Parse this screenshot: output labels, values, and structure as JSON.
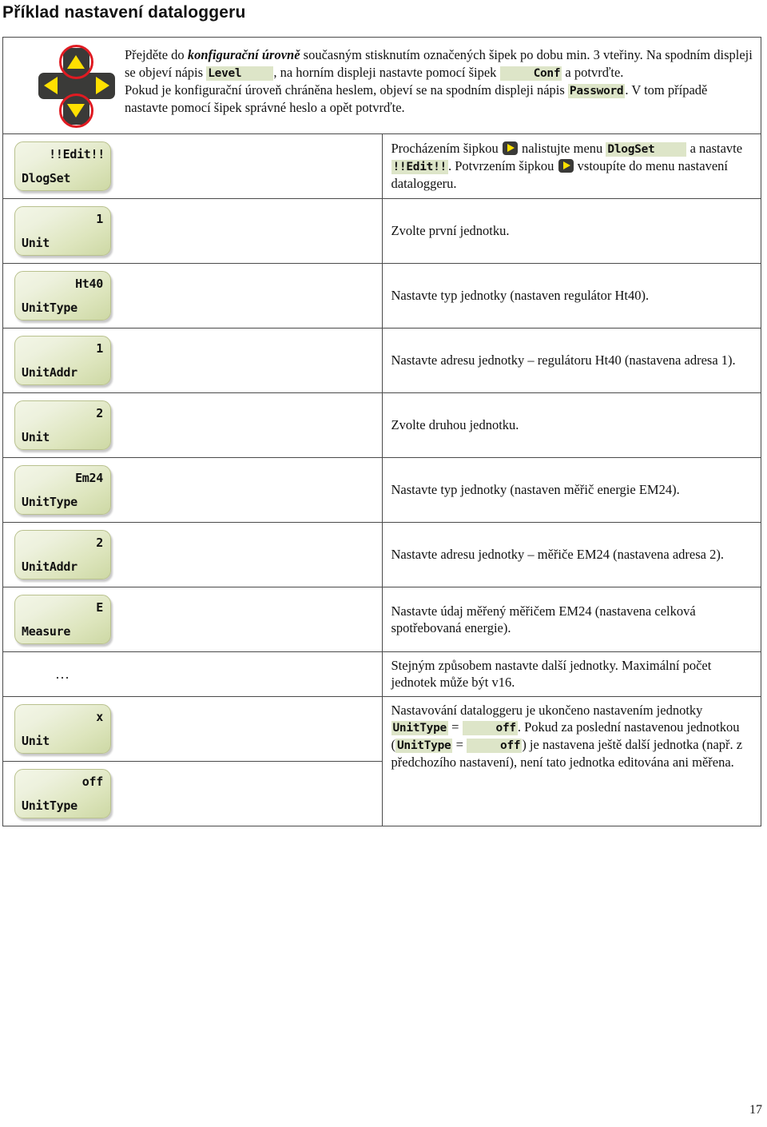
{
  "page": {
    "title": "Příklad nastavení dataloggeru",
    "number": "17"
  },
  "intro": {
    "keypad": {
      "up_icon": "arrow-up-icon",
      "down_icon": "arrow-down-icon",
      "left_icon": "arrow-left-icon",
      "right_icon": "arrow-right-icon"
    },
    "t1": "Přejděte do ",
    "t1_em": "konfigurační úrovně",
    "t2": " současným stisknutím označených šipek po dobu min. 3 vteřiny. Na spodním displeji se objeví nápis ",
    "chip_level": "Level",
    "t3": ", na horním displeji nastavte pomocí šipek ",
    "chip_conf": "Conf",
    "t4": " a potvrďte.",
    "t5": "Pokud je konfigurační úroveň chráněna heslem, objeví se na spodním displeji nápis ",
    "chip_password": "Password",
    "t6": ". V tom případě nastavte pomocí šipek správné heslo a opět potvrďte."
  },
  "rows": [
    {
      "display": {
        "value": "!!Edit!!",
        "label": "DlogSet",
        "wide": true
      },
      "text_parts": {
        "a": "Procházením šipkou ",
        "icon1": "arrow-right-key-icon",
        "b": " nalistujte menu ",
        "chip1": "DlogSet",
        "c": " a nastavte ",
        "chip2": "!!Edit!!",
        "d": ". Potvrzením šipkou ",
        "icon2": "arrow-right-key-icon",
        "e": " vstoupíte do menu nastavení dataloggeru."
      }
    },
    {
      "display": {
        "value": "1",
        "label": "Unit"
      },
      "text": "Zvolte první jednotku."
    },
    {
      "display": {
        "value": "Ht40",
        "label": "UnitType"
      },
      "text": "Nastavte typ jednotky (nastaven regulátor Ht40)."
    },
    {
      "display": {
        "value": "1",
        "label": "UnitAddr"
      },
      "text": "Nastavte adresu jednotky – regulátoru Ht40 (nastavena adresa 1)."
    },
    {
      "display": {
        "value": "2",
        "label": "Unit"
      },
      "text": "Zvolte druhou jednotku."
    },
    {
      "display": {
        "value": "Em24",
        "label": "UnitType"
      },
      "text": "Nastavte typ jednotky (nastaven měřič energie EM24)."
    },
    {
      "display": {
        "value": "2",
        "label": "UnitAddr"
      },
      "text": "Nastavte adresu jednotky – měřiče EM24 (nastavena adresa 2)."
    },
    {
      "display": {
        "value": "E",
        "label": "Measure"
      },
      "text": "Nastavte údaj měřený měřičem EM24 (nastavena celková spotřebovaná energie)."
    },
    {
      "display": {
        "ellipsis": "…"
      },
      "text": "Stejným způsobem nastavte další jednotky. Maximální počet jednotek může být v16."
    },
    {
      "display": {
        "value": "x",
        "label": "Unit"
      },
      "final_text": {
        "a": "Nastavování dataloggeru je ukončeno nastavením jednotky ",
        "chip1": "UnitType",
        "b": " = ",
        "chip2": "off",
        "c": ". Pokud za poslední nastavenou jednotkou (",
        "chip3": "UnitType",
        "d": " = ",
        "chip4": "off",
        "e": ") je nastavena ještě další jednotka (např. z předchozího nastavení), není tato jednotka editována ani měřena."
      }
    },
    {
      "display": {
        "value": "off",
        "label": "UnitType"
      },
      "text": ""
    }
  ],
  "colors": {
    "chip_highlight": "#dde5c8",
    "display_border": "#b9c18e",
    "key_body": "#3a3a38",
    "arrow_yellow": "#ffe000",
    "ring_red": "#e01b22",
    "table_border": "#4a4a4a"
  }
}
